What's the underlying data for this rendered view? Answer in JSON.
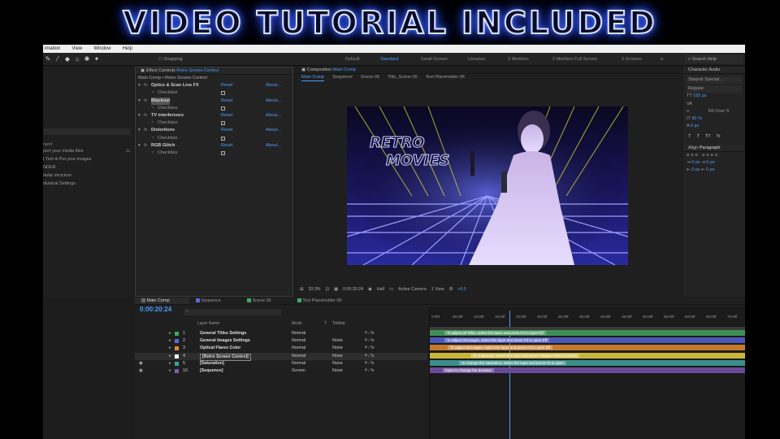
{
  "banner": {
    "title": "VIDEO TUTORIAL INCLUDED"
  },
  "menubar": {
    "items": [
      "imation",
      "View",
      "Window",
      "Help"
    ]
  },
  "toolbar": {
    "snapping": "Snapping",
    "workspaces": [
      "Default",
      "Standard",
      "Small Screen",
      "Libraries",
      "2 Monitors",
      "2 Monitors Full Screen",
      "2 Screens"
    ],
    "active_workspace": "Standard",
    "search_placeholder": "Search Help"
  },
  "project": {
    "items": [
      "port your media files",
      "t Text & Put your images",
      "NDER",
      "dular structure",
      "dividual  Settings"
    ],
    "section": "ment"
  },
  "effect_controls": {
    "tab_title": "Effect Controls",
    "tab_layer": "Retro Screen Control",
    "breadcrumb": "Main Comp • Retro Screen Control",
    "reset": "Reset",
    "about": "About...",
    "checkbox_label": "Checkbox",
    "effects": [
      {
        "name": "Optics & Scan Line FX",
        "checked": false
      },
      {
        "name": "Blackout",
        "checked": false
      },
      {
        "name": "TV interference",
        "checked": true
      },
      {
        "name": "Distortions",
        "checked": true
      },
      {
        "name": "RGB Glitch",
        "checked": true
      }
    ]
  },
  "composition": {
    "tab_title": "Composition",
    "tab_comp": "Main Comp",
    "breadcrumbs": [
      "Main Comp",
      "Sequence",
      "Scene 06",
      "Title_Scene 06",
      "Text Placeholder 06"
    ],
    "overlay_text_1": "RETRO",
    "overlay_text_2": "MOVIES"
  },
  "viewer_footer": {
    "zoom": "33.3%",
    "timecode": "0:00:20:24",
    "resolution": "Half",
    "camera": "Active Camera",
    "view": "1 View",
    "exposure": "+0.0"
  },
  "character": {
    "tab": "Character",
    "tab2": "Audio",
    "font": "Starjedi Special ...",
    "style": "Regular",
    "size": "165 px",
    "tracking_label": "90 %",
    "fill": "Fill Over S",
    "zero_px": "0 px",
    "styles": [
      "T",
      "T",
      "TT",
      "Tr"
    ]
  },
  "paragraph": {
    "tab_align": "Align",
    "tab_para": "Paragraph",
    "indents": [
      "0 px",
      "0 px",
      "0 px",
      "0 px"
    ]
  },
  "timeline": {
    "tabs": [
      "Main Comp",
      "Sequence",
      "Scene 06",
      "Text Placeholder 06"
    ],
    "tab_colors": [
      "#6a6a6a",
      "#5c6ad6",
      "#3fa860",
      "#3fa860"
    ],
    "timecode": "0:00:20:24",
    "col_layer": "Layer Name",
    "col_mode": "Mode",
    "col_t": "T",
    "col_trkmat": "TrkMat",
    "ruler": [
      "0:00f",
      "05:00f",
      "10:00f",
      "15:00f",
      "20:00f",
      "25:00f",
      "30:00f",
      "35:00f",
      "40:00f",
      "45:00f",
      "50:00f",
      "55:00f",
      "60:00f",
      "65:00f",
      "70:00f"
    ],
    "layers": [
      {
        "num": "1",
        "name": "General Titles Settings",
        "color": "#3fa860",
        "mode": "Normal",
        "trk": ""
      },
      {
        "num": "2",
        "name": "General Images Settings",
        "color": "#5c6ad6",
        "mode": "Normal",
        "trk": "None"
      },
      {
        "num": "3",
        "name": "Optical Flares Color",
        "color": "#e08a30",
        "mode": "Normal",
        "trk": "None"
      },
      {
        "num": "4",
        "name": "[Retro Screen Control]",
        "color": "#ffffff",
        "mode": "Normal",
        "trk": "None"
      },
      {
        "num": "5",
        "name": "[Saturation]",
        "color": "#3aa0a0",
        "mode": "Normal",
        "trk": "None"
      },
      {
        "num": "10",
        "name": "[Sequence]",
        "color": "#7a5ab0",
        "mode": "Screen",
        "trk": "None"
      }
    ],
    "bars": [
      {
        "label": "To adjust all Titles, select the layer and press F3 to open Eff",
        "color": "#3f8f55"
      },
      {
        "label": "To adjust all Images, select the layer and press F3 to open Eff",
        "color": "#4b57b8"
      },
      {
        "label": "To adjust all Images, select the layer and press F3 to open Eff",
        "color": "#c37a2c"
      },
      {
        "label": "To customize, select the layer and press F3(open Effect Control)",
        "color": "#c8b53a"
      },
      {
        "label": "To change the saturation, select the layer and press F3 to open",
        "color": "#3a8e8a"
      },
      {
        "label": "Open to change the duration",
        "color": "#6a4a98"
      }
    ]
  }
}
